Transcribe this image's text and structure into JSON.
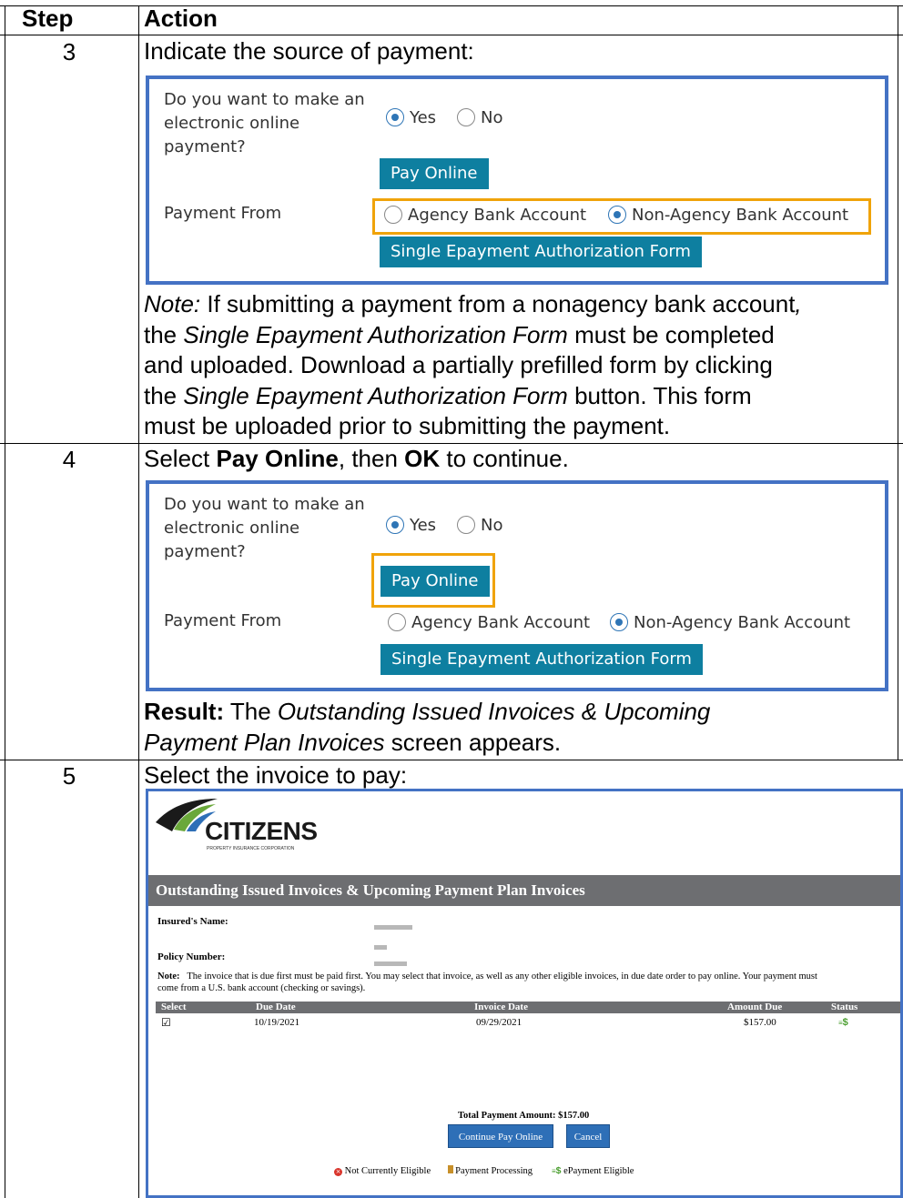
{
  "header": {
    "step": "Step",
    "action": "Action"
  },
  "step3": {
    "number": "3",
    "instruction": "Indicate the source of payment:",
    "panel": {
      "question_l1": "Do you want to make an",
      "question_l2": "electronic online",
      "question_l3": "payment?",
      "yes": "Yes",
      "no": "No",
      "yes_selected": true,
      "pay_online": "Pay Online",
      "payment_from": "Payment From",
      "agency": "Agency Bank Account",
      "non_agency": "Non-Agency Bank Account",
      "non_agency_selected": true,
      "sea_form": "Single Epayment Authorization Form"
    },
    "note": {
      "label": "Note:",
      "t1": " If submitting a payment from a nonagency bank account",
      "t1b": ",",
      "t2": "the ",
      "t2i": "Single Epayment Authorization Form",
      "t2b": " must be completed",
      "t3": "and uploaded. Download a partially prefilled form by clicking",
      "t4": "the ",
      "t4i": "Single Epayment Authorization Form",
      "t4b": " button. This form",
      "t5": "must be uploaded prior to submitting the payment."
    }
  },
  "step4": {
    "number": "4",
    "i1": "Select ",
    "i2": "Pay Online",
    "i3": ", then ",
    "i4": "OK",
    "i5": " to continue.",
    "result_label": "Result:",
    "result_t1": " The ",
    "result_i1": "Outstanding Issued Invoices & Upcoming",
    "result_i2": "Payment Plan Invoices",
    "result_t2": " screen appears."
  },
  "step5": {
    "number": "5",
    "instruction": "Select the invoice to pay:",
    "screen": {
      "brand": "CITIZENS",
      "brand_sub": "PROPERTY INSURANCE CORPORATION",
      "title": "Outstanding Issued Invoices & Upcoming Payment Plan Invoices",
      "insured_label": "Insured's Name:",
      "policy_label": "Policy Number:",
      "note_label": "Note:",
      "note_l1": "The invoice that is due first must be paid first. You may select that invoice, as well as any other eligible invoices, in due date order to pay online. Your payment must",
      "note_l2": "come from a U.S. bank account (checking or savings).",
      "columns": [
        "Select",
        "Due Date",
        "Invoice Date",
        "Amount Due",
        "Status"
      ],
      "row": {
        "checked": true,
        "check": "☑",
        "due": "10/19/2021",
        "invoice": "09/29/2021",
        "amount": "$157.00",
        "status": "$"
      },
      "total": "Total Payment Amount:  $157.00",
      "continue": "Continue Pay Online",
      "cancel": "Cancel",
      "legend_not": "Not Currently Eligible",
      "legend_processing": "Payment Processing",
      "legend_eligible": "ePayment Eligible",
      "legend_eligible_icon": "$"
    }
  },
  "colors": {
    "panel_border": "#4472c4",
    "highlight": "#f0a30a",
    "button": "#0e7fa0",
    "header_bar": "#6d6e71"
  }
}
